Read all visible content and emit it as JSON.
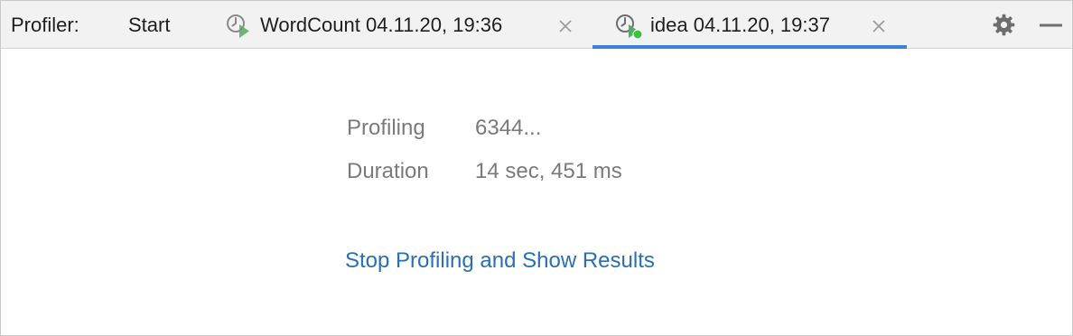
{
  "toolbar": {
    "title": "Profiler:",
    "start_label": "Start",
    "tabs": [
      {
        "label": "WordCount 04.11.20, 19:36",
        "active": false,
        "icon": "profiler-snapshot-icon"
      },
      {
        "label": "idea 04.11.20, 19:37",
        "active": true,
        "icon": "profiler-running-icon"
      }
    ],
    "settings_icon": "gear-icon",
    "minimize_icon": "minimize-icon"
  },
  "status": {
    "profiling_label": "Profiling",
    "profiling_value": "6344...",
    "duration_label": "Duration",
    "duration_value": "14 sec, 451 ms"
  },
  "actions": {
    "stop_label": "Stop Profiling and Show Results"
  },
  "colors": {
    "accent": "#3d82d6",
    "link": "#2a6fb3",
    "running_dot": "#3ec33e",
    "play_green": "#59a869"
  }
}
